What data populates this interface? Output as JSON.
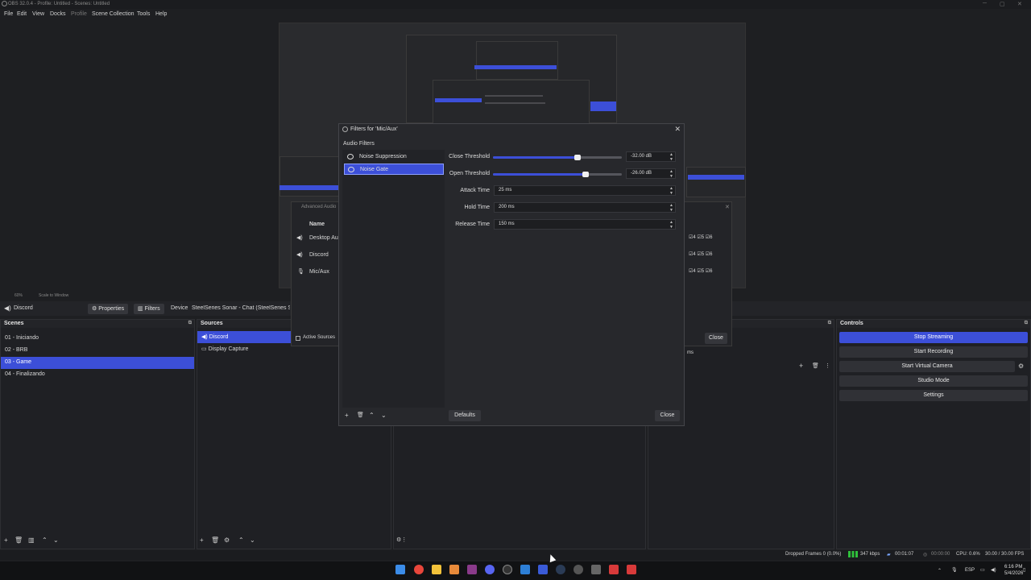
{
  "window": {
    "title": "OBS 32.0.4 - Profile: Untitled - Scenes: Untitled"
  },
  "menu": [
    "File",
    "Edit",
    "View",
    "Docks",
    "Profile",
    "Scene Collection",
    "Tools",
    "Help"
  ],
  "scene_toolbar": {
    "zoom": "60%",
    "mode": "Scale to Window"
  },
  "source_toolbar": {
    "source": "Discord",
    "properties": "Properties",
    "filters": "Filters",
    "device_label": "Device",
    "device_value": "SteelSeries Sonar - Chat (SteelSeries Sonar"
  },
  "scenes": {
    "title": "Scenes",
    "items": [
      "01 - Iniciando",
      "02 - BRB",
      "03 - Game",
      "04 - Finalizando"
    ],
    "selected": 2
  },
  "sources": {
    "title": "Sources",
    "items": [
      "Discord",
      "Display Capture"
    ],
    "selected": 0
  },
  "advanced_audio": {
    "title": "Advanced Audio",
    "col_name": "Name",
    "rows": [
      "Desktop Aud",
      "Discord",
      "Mic/Aux"
    ],
    "active_sources": "Active Sources",
    "close": "Close",
    "unit": "ms",
    "tracks": [
      "4",
      "5",
      "6"
    ]
  },
  "controls": {
    "title": "Controls",
    "buttons": [
      "Stop Streaming",
      "Start Recording",
      "Start Virtual Camera",
      "Studio Mode",
      "Settings"
    ]
  },
  "filters_dialog": {
    "title": "Filters for 'Mic/Aux'",
    "section": "Audio Filters",
    "filters": [
      "Noise Suppression",
      "Noise Gate"
    ],
    "selected": 1,
    "params": {
      "close_threshold": {
        "label": "Close Threshold",
        "value": "-32.00 dB",
        "fill": 0.65
      },
      "open_threshold": {
        "label": "Open Threshold",
        "value": "-26.00 dB",
        "fill": 0.7
      },
      "attack_time": {
        "label": "Attack Time",
        "value": "25 ms"
      },
      "hold_time": {
        "label": "Hold Time",
        "value": "200 ms"
      },
      "release_time": {
        "label": "Release Time",
        "value": "150 ms"
      }
    },
    "defaults": "Defaults",
    "close": "Close"
  },
  "status": {
    "dropped": "Dropped Frames 0 (0.0%)",
    "kbps": "347 kbps",
    "live_time": "00:01:07",
    "rec_time": "00:00:00",
    "cpu": "CPU: 0.6%",
    "fps": "30.00 / 30.00 FPS"
  },
  "tray": {
    "lang": "ESP",
    "time": "6:16 PM",
    "date": "5/4/2026"
  },
  "colors": {
    "accent": "#3c4fd8",
    "bg": "#1e1f22",
    "panel": "#27282c"
  },
  "icons": [
    "eye-icon",
    "plus-icon",
    "trash-icon",
    "up-icon",
    "down-icon",
    "gear-icon",
    "speaker-icon",
    "mic-icon",
    "monitor-icon"
  ]
}
